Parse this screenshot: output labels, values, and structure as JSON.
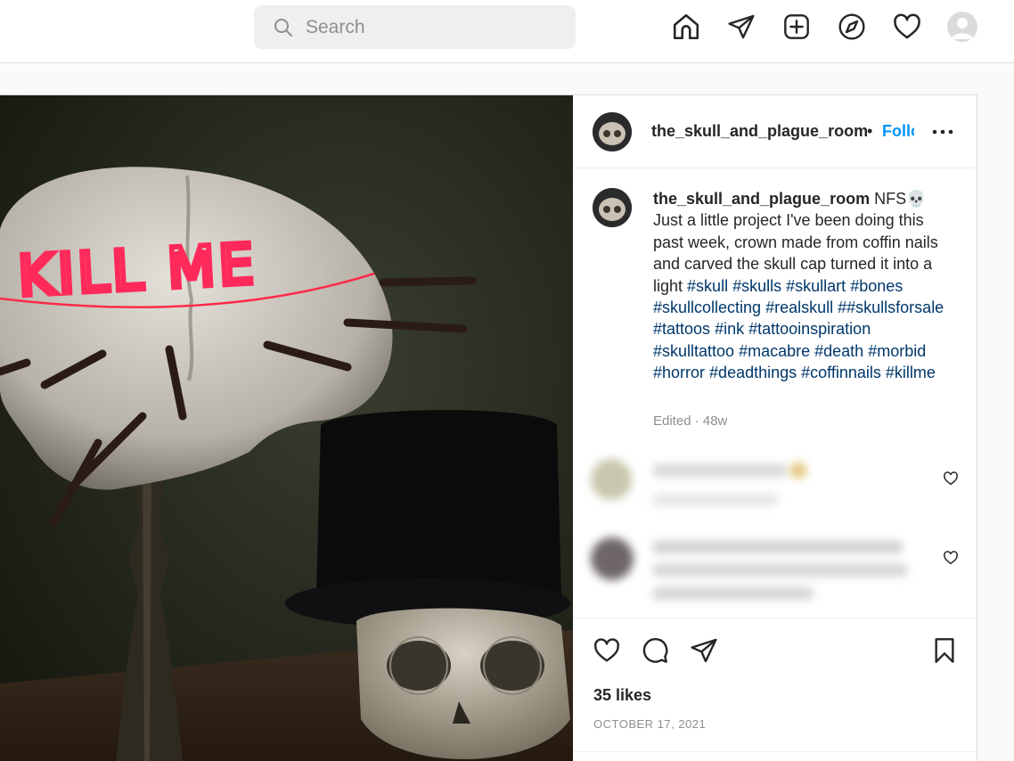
{
  "nav": {
    "search_placeholder": "Search",
    "icons": [
      "home-icon",
      "direct-message-icon",
      "new-post-icon",
      "explore-icon",
      "activity-heart-icon",
      "profile-avatar"
    ]
  },
  "post": {
    "username": "the_skull_and_plague_room",
    "follow_label": "Follow",
    "separator": "•",
    "caption": {
      "username": "the_skull_and_plague_room",
      "text": "NFS💀 Just a little project I've been doing this past week, crown made from coffin nails and carved the skull cap turned it into a light",
      "hashtags": [
        "#skull",
        "#skulls",
        "#skullart",
        "#bones",
        "#skullcollecting",
        "#realskull",
        "##skullsforsale",
        "#tattoos",
        "#ink",
        "#tattooinspiration",
        "#skulltattoo",
        "#macabre",
        "#death",
        "#morbid",
        "#horror",
        "#deadthings",
        "#coffinnails",
        "#killme"
      ]
    },
    "edited": "Edited · 48w",
    "likes": "35 likes",
    "date": "OCTOBER 17, 2021",
    "photo_text": "KILL ME"
  },
  "colors": {
    "link_blue": "#0095f6",
    "hashtag": "#00376b",
    "muted": "#8e8e8e",
    "border": "#dbdbdb"
  }
}
